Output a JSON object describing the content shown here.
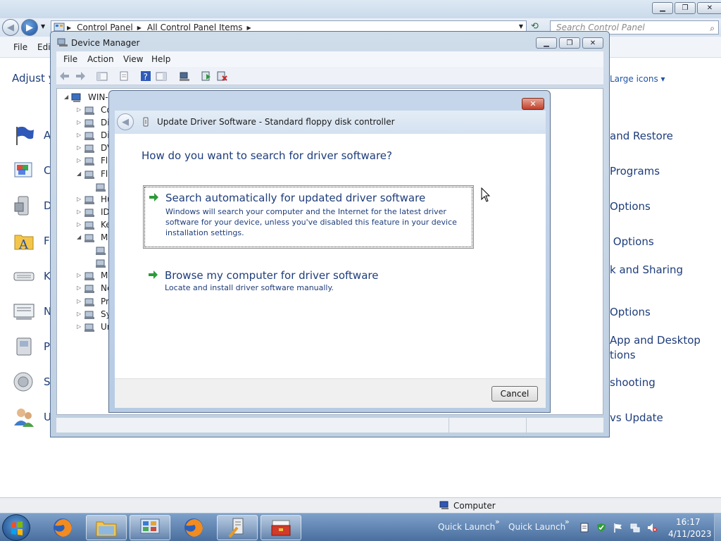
{
  "control_panel": {
    "address": {
      "crumbs": [
        "Control Panel",
        "All Control Panel Items"
      ]
    },
    "search_placeholder": "Search Control Panel",
    "menu": {
      "file": "File",
      "edit": "Edit"
    },
    "heading_partial": "Adjust y",
    "view_by": "Large icons ▾",
    "left_items": [
      {
        "text": "A",
        "icon": "action-center-flag-icon"
      },
      {
        "text": "C",
        "icon": "color-management-icon"
      },
      {
        "text": "D",
        "icon": "device-printer-icon"
      },
      {
        "text": "F",
        "icon": "fonts-folder-icon"
      },
      {
        "text": "K",
        "icon": "keyboard-icon"
      },
      {
        "text": "N",
        "icon": "network-icon"
      },
      {
        "text": "P",
        "icon": "phone-modem-icon"
      },
      {
        "text": "S",
        "icon": "sound-speaker-icon"
      },
      {
        "text": "U",
        "icon": "user-accounts-icon"
      }
    ],
    "right_items": [
      "and Restore",
      "Programs",
      "Options",
      " Options",
      "k and Sharing",
      "Options",
      "App and Desktop\ntions",
      "shooting",
      "vs Update"
    ]
  },
  "device_manager": {
    "title": "Device Manager",
    "menu": [
      "File",
      "Action",
      "View",
      "Help"
    ],
    "tree_root": "WIN-I",
    "tree_items": [
      {
        "label": "Co",
        "exp": "▷"
      },
      {
        "label": "Di",
        "exp": "▷"
      },
      {
        "label": "Di",
        "exp": "▷"
      },
      {
        "label": "DV",
        "exp": "▷"
      },
      {
        "label": "Fl",
        "exp": "▷"
      },
      {
        "label": "Fl",
        "exp": "◢"
      },
      {
        "label": "",
        "exp": ""
      },
      {
        "label": "Hu",
        "exp": "▷"
      },
      {
        "label": "ID",
        "exp": "▷"
      },
      {
        "label": "Ke",
        "exp": "▷"
      },
      {
        "label": "M",
        "exp": "◢"
      },
      {
        "label": "",
        "exp": ""
      },
      {
        "label": "",
        "exp": ""
      },
      {
        "label": "M",
        "exp": "▷"
      },
      {
        "label": "Ne",
        "exp": "▷"
      },
      {
        "label": "Pr",
        "exp": "▷"
      },
      {
        "label": "Sy",
        "exp": "▷"
      },
      {
        "label": "Ur",
        "exp": "▷"
      }
    ]
  },
  "update_driver": {
    "title": "Update Driver Software - Standard floppy disk controller",
    "question": "How do you want to search for driver software?",
    "options": [
      {
        "title": "Search automatically for updated driver software",
        "description": "Windows will search your computer and the Internet for the latest driver software for your device, unless you've disabled this feature in your device installation settings."
      },
      {
        "title": "Browse my computer for driver software",
        "description": "Locate and install driver software manually."
      }
    ],
    "cancel_label": "Cancel",
    "close_glyph": "✕"
  },
  "deskbar": {
    "label": "Computer"
  },
  "taskbar": {
    "quick_launch": [
      "Quick Launch",
      "Quick Launch"
    ],
    "chevron": "»",
    "time": "16:17",
    "date": "4/11/2023"
  },
  "colors": {
    "link_blue": "#1e3d7b",
    "green_arrow": "#2e9a3a",
    "close_red": "#c0402a"
  }
}
